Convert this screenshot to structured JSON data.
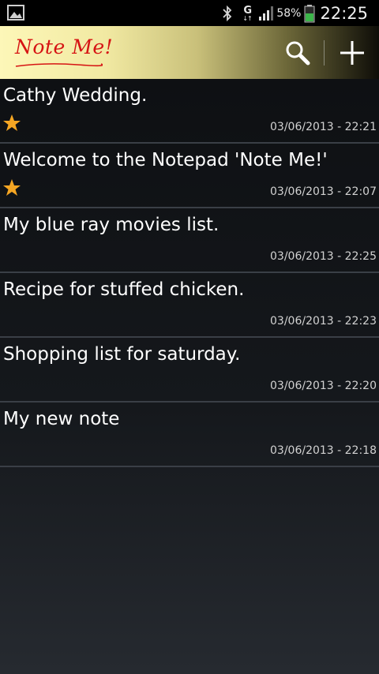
{
  "status_bar": {
    "battery_percent": "58%",
    "time": "22:25",
    "network_letter": "G",
    "icons": [
      "gallery-icon",
      "bluetooth-icon",
      "network-g-icon",
      "signal-icon",
      "battery-icon"
    ],
    "battery_color": "#3cb64a"
  },
  "action_bar": {
    "title": "Note Me!",
    "title_color": "#d61414",
    "search_icon": "search-icon",
    "add_icon": "plus-icon"
  },
  "notes": [
    {
      "title": "Cathy Wedding.",
      "date": "03/06/2013 - 22:21",
      "starred": true
    },
    {
      "title": "Welcome to the Notepad 'Note Me!'",
      "date": "03/06/2013 - 22:07",
      "starred": true
    },
    {
      "title": "My blue ray movies list.",
      "date": "03/06/2013 - 22:25",
      "starred": false
    },
    {
      "title": "Recipe for stuffed chicken.",
      "date": "03/06/2013 - 22:23",
      "starred": false
    },
    {
      "title": "Shopping list for saturday.",
      "date": "03/06/2013 - 22:20",
      "starred": false
    },
    {
      "title": "My new note",
      "date": "03/06/2013 - 22:18",
      "starred": false
    }
  ],
  "star_color": "#f5a623"
}
